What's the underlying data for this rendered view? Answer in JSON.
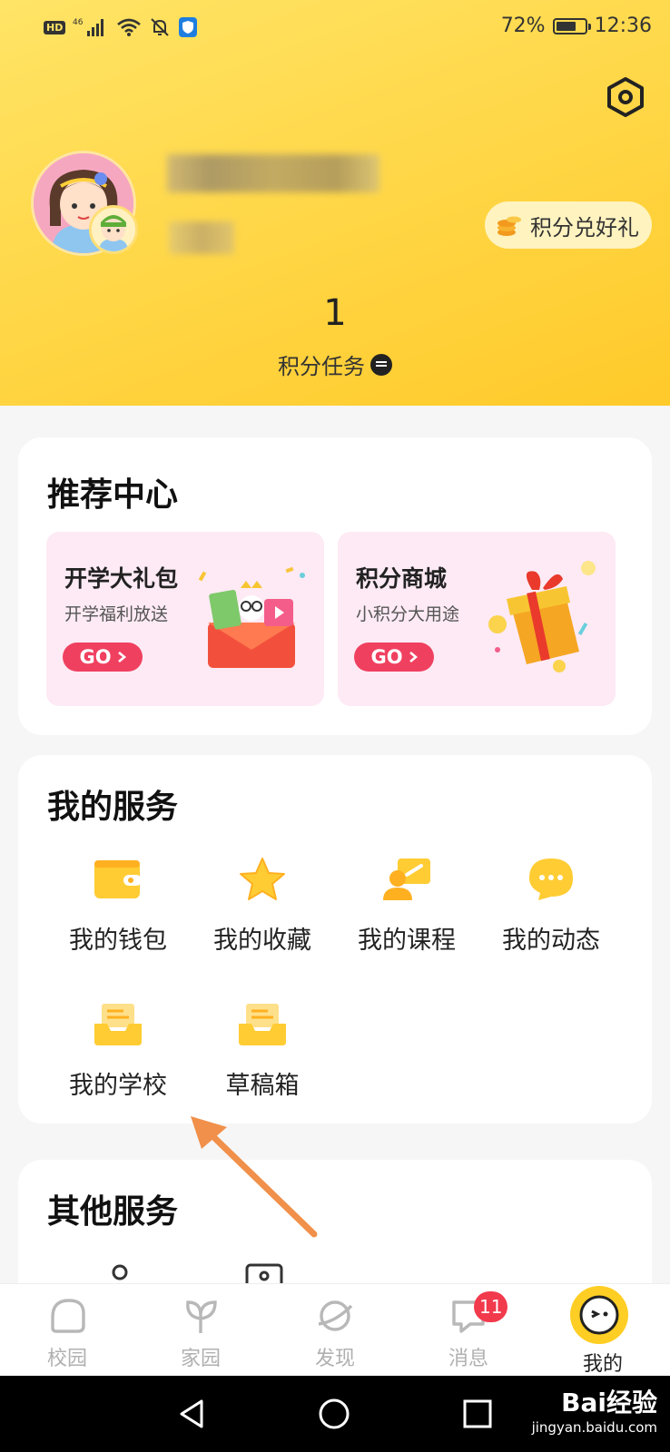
{
  "status_bar": {
    "hd": "HD",
    "network": "46",
    "battery_percent_text": "72%",
    "battery_level": 0.72,
    "time": "12:36"
  },
  "profile": {
    "avatar": "mother-avatar",
    "child_avatar": "child-avatar",
    "exchange_label": "积分兑好礼",
    "points_value": "1",
    "points_task_label": "积分任务"
  },
  "recommend": {
    "title": "推荐中心",
    "promos": [
      {
        "title": "开学大礼包",
        "subtitle": "开学福利放送",
        "go": "GO"
      },
      {
        "title": "积分商城",
        "subtitle": "小积分大用途",
        "go": "GO"
      }
    ]
  },
  "my_services": {
    "title": "我的服务",
    "items": [
      {
        "label": "我的钱包",
        "icon": "wallet-icon"
      },
      {
        "label": "我的收藏",
        "icon": "star-icon"
      },
      {
        "label": "我的课程",
        "icon": "course-icon"
      },
      {
        "label": "我的动态",
        "icon": "chat-bubble-icon"
      },
      {
        "label": "我的学校",
        "icon": "tray-icon"
      },
      {
        "label": "草稿箱",
        "icon": "tray-icon"
      }
    ]
  },
  "other_services": {
    "title": "其他服务"
  },
  "bottom_nav": {
    "items": [
      {
        "label": "校园",
        "icon": "campus-icon",
        "active": false
      },
      {
        "label": "家园",
        "icon": "leaf-icon",
        "active": false
      },
      {
        "label": "发现",
        "icon": "planet-icon",
        "active": false
      },
      {
        "label": "消息",
        "icon": "message-icon",
        "active": false,
        "badge": "11"
      },
      {
        "label": "我的",
        "icon": "me-face-icon",
        "active": true
      }
    ]
  },
  "watermark": {
    "main": "Bai经验",
    "sub": "jingyan.baidu.com"
  },
  "colors": {
    "header_yellow": "#ffd84a",
    "accent_red": "#f04060",
    "badge_red": "#f23a4d",
    "icon_yellow": "#ffcc33"
  }
}
